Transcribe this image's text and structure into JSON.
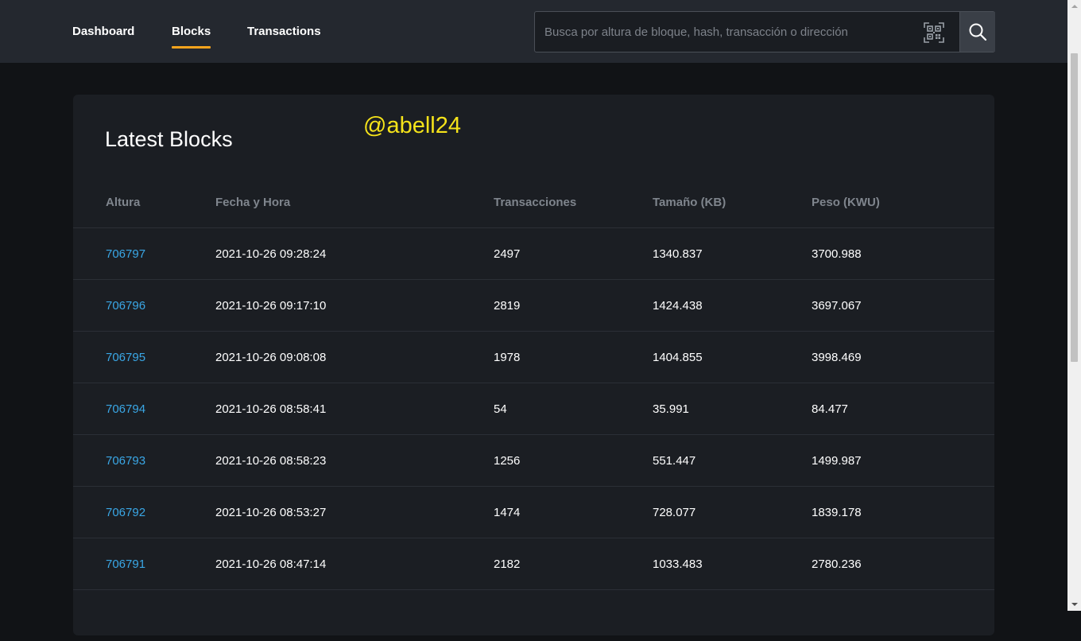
{
  "nav": {
    "dashboard": "Dashboard",
    "blocks": "Blocks",
    "transactions": "Transactions",
    "active": "Blocks"
  },
  "search": {
    "placeholder": "Busca por altura de bloque, hash, transacción o dirección",
    "value": "",
    "qr_icon": "qr-code-icon",
    "button_icon": "search-icon"
  },
  "card": {
    "title": "Latest Blocks",
    "watermark": "@abell24"
  },
  "table": {
    "headers": {
      "height": "Altura",
      "datetime": "Fecha y Hora",
      "txs": "Transacciones",
      "size": "Tamaño (KB)",
      "weight": "Peso (KWU)"
    },
    "rows": [
      {
        "height": "706797",
        "datetime": "2021-10-26 09:28:24",
        "txs": "2497",
        "size": "1340.837",
        "weight": "3700.988"
      },
      {
        "height": "706796",
        "datetime": "2021-10-26 09:17:10",
        "txs": "2819",
        "size": "1424.438",
        "weight": "3697.067"
      },
      {
        "height": "706795",
        "datetime": "2021-10-26 09:08:08",
        "txs": "1978",
        "size": "1404.855",
        "weight": "3998.469"
      },
      {
        "height": "706794",
        "datetime": "2021-10-26 08:58:41",
        "txs": "54",
        "size": "35.991",
        "weight": "84.477"
      },
      {
        "height": "706793",
        "datetime": "2021-10-26 08:58:23",
        "txs": "1256",
        "size": "551.447",
        "weight": "1499.987"
      },
      {
        "height": "706792",
        "datetime": "2021-10-26 08:53:27",
        "txs": "1474",
        "size": "728.077",
        "weight": "1839.178"
      },
      {
        "height": "706791",
        "datetime": "2021-10-26 08:47:14",
        "txs": "2182",
        "size": "1033.483",
        "weight": "2780.236"
      }
    ]
  },
  "colors": {
    "accent": "#f7a41d",
    "link": "#3aa7e6",
    "watermark": "#f5e31a",
    "header_bg": "#24282f",
    "page_bg": "#111316",
    "card_bg": "#1b1e23"
  }
}
